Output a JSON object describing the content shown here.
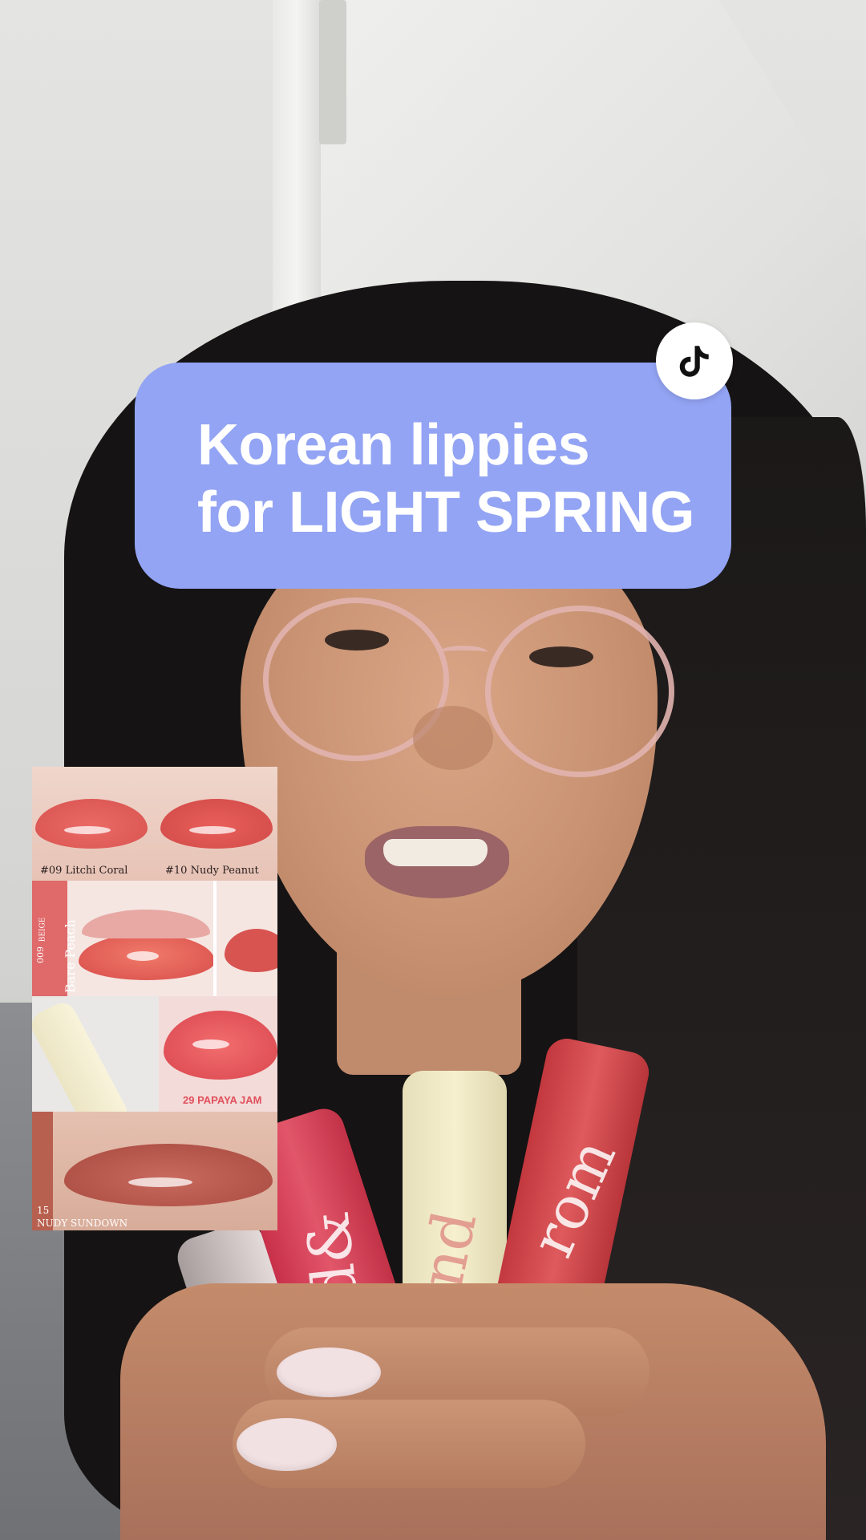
{
  "caption": {
    "line1": "Korean lippies",
    "line2": "for LIGHT SPRING",
    "background": "#93a4f4"
  },
  "watermark": {
    "icon": "tiktok-logo-icon"
  },
  "collage": {
    "tile1_left_label": "#09 Litchi Coral",
    "tile1_right_label": "#10 Nudy Peanut",
    "tile2_number": "009",
    "tile2_badge": "BEIGE",
    "tile2_name": "Bare Peach",
    "tile3_label": "29 PAPAYA JAM",
    "tile4_number": "15",
    "tile4_name": "NUDY SUNDOWN"
  },
  "products": {
    "brand_mark_1": "nd&",
    "brand_mark_2": "nd",
    "brand_mark_3": "rom"
  },
  "colors": {
    "coral": "#e4606a",
    "cream": "#f2ecc8",
    "pink_red": "#d9455a",
    "rose": "#c9565a"
  }
}
